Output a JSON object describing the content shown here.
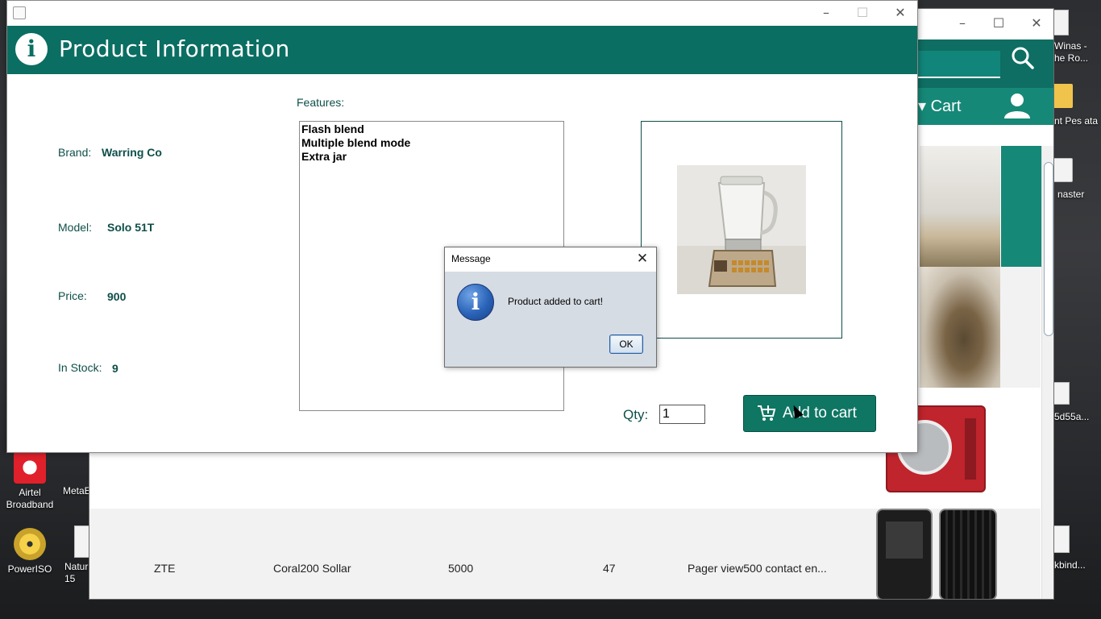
{
  "desktop": {
    "icons": [
      {
        "label": "Airtel Broadband"
      },
      {
        "label": "PowerISO"
      }
    ],
    "fragments": [
      "MetaE",
      "Natur 15",
      "Winas - he Ro...",
      "nt Pes ata",
      "naster",
      "5d55a...",
      "kbind..."
    ]
  },
  "store_window": {
    "cart_label": "Cart",
    "rows": [
      {
        "brand": "ZTE",
        "model": "Coral200 Sollar",
        "price": "5000",
        "stock": "47",
        "features": "Pager view500 contact en..."
      }
    ]
  },
  "product_window": {
    "title": "Product Information",
    "brand_label": "Brand:",
    "brand_value": "Warring Co",
    "model_label": "Model:",
    "model_value": "Solo 51T",
    "price_label": "Price:",
    "price_value": "900",
    "stock_label": "In Stock:",
    "stock_value": "9",
    "features_label": "Features:",
    "features": [
      "Flash blend",
      "Multiple blend mode",
      "Extra jar"
    ],
    "qty_label": "Qty:",
    "qty_value": "1",
    "add_to_cart_label": "Add to cart",
    "accent_color": "#0a6e62"
  },
  "dialog": {
    "title": "Message",
    "message": "Product added to cart!",
    "ok_label": "OK"
  }
}
